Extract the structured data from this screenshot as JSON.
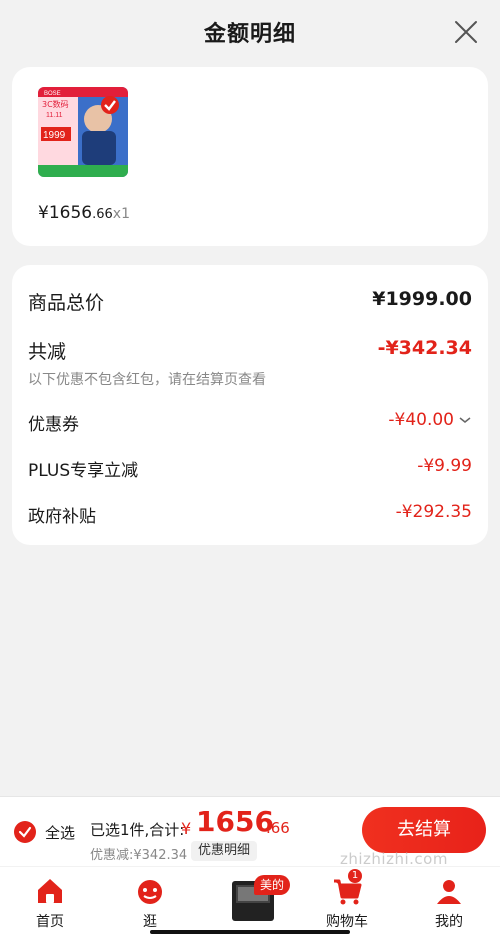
{
  "header": {
    "title": "金额明细"
  },
  "product": {
    "price_yen": "¥",
    "price_int": "1656",
    "price_dec": ".66",
    "quantity": "x1",
    "thumb": {
      "brand": "BOSE",
      "tag": "3C数码",
      "date": "11.11",
      "price": "1999"
    }
  },
  "breakdown": {
    "total_label": "商品总价",
    "total_value": "¥1999.00",
    "reduce_label": "共减",
    "reduce_value": "-¥342.34",
    "note": "以下优惠不包含红包，请在结算页查看",
    "coupon_label": "优惠券",
    "coupon_value": "-¥40.00",
    "plus_label": "PLUS专享立减",
    "plus_value": "-¥9.99",
    "gov_label": "政府补贴",
    "gov_value": "-¥292.35"
  },
  "checkout": {
    "select_all": "全选",
    "selected": "已选1件,合计:",
    "sum_yen": "¥",
    "sum_int": "1656",
    "sum_dec": ".66",
    "discount": "优惠减:¥342.34",
    "detail_button": "优惠明细",
    "go_button": "去结算"
  },
  "tabs": {
    "home": "首页",
    "browse": "逛",
    "promo_badge": "美的",
    "cart": "购物车",
    "cart_badge": "1",
    "me": "我的"
  },
  "watermark": "zhizhizhi.com",
  "colors": {
    "accent": "#e2231a",
    "background": "#f2f2f2"
  }
}
